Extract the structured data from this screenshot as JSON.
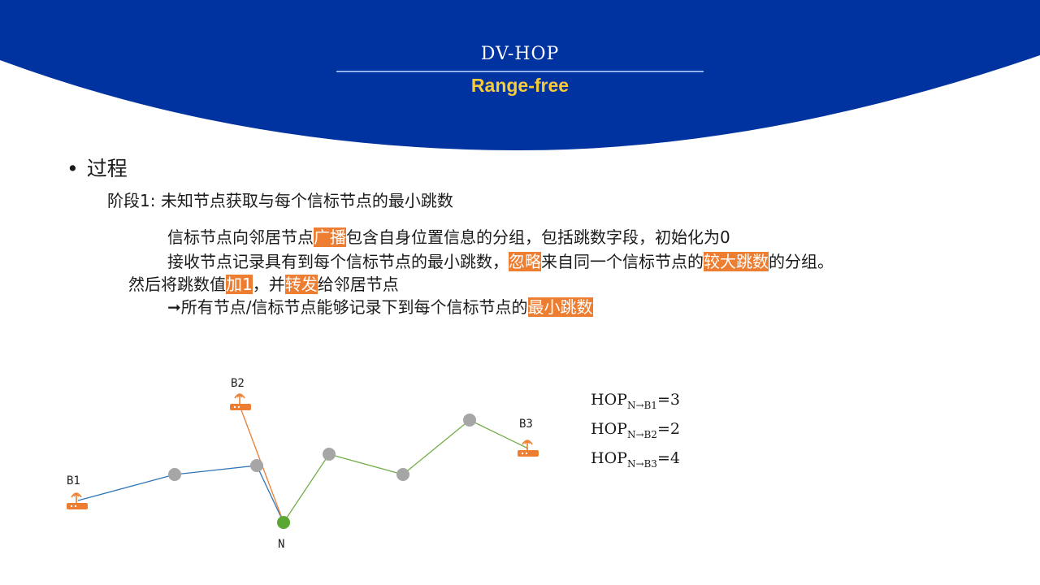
{
  "header": {
    "title": "DV-HOP",
    "subtitle": "Range-free",
    "bg_color": "#0033a0",
    "subtitle_color": "#f5cb3c"
  },
  "section": {
    "bullet": "•",
    "heading": "过程"
  },
  "stage": {
    "label": "阶段1: 未知节点获取与每个信标节点的最小跳数"
  },
  "highlight_color": "#ed7d31",
  "paragraphs": {
    "p1": {
      "a": "信标节点向邻居节点",
      "h1": "广播",
      "b": "包含自身位置信息的分组，包括跳数字段，初始化为0"
    },
    "p2": {
      "a": "接收节点记录具有到每个信标节点的最小跳数，",
      "h1": "忽略",
      "b": "来自同一个信标节点的",
      "h2": "较大跳数",
      "c": "的分组。"
    },
    "p3": {
      "a": "然后将跳数值",
      "h1": "加1",
      "b": "，并",
      "h2": "转发",
      "c": "给邻居节点"
    },
    "p4": {
      "a": "➞所有节点/信标节点能够记录下到每个信标节点的",
      "h1": "最小跳数"
    }
  },
  "hops": [
    {
      "prefix": "HOP",
      "sub": "N→B1",
      "value": "=3"
    },
    {
      "prefix": "HOP",
      "sub": "N→B2",
      "value": "=2"
    },
    {
      "prefix": "HOP",
      "sub": "N→B3",
      "value": "=4"
    }
  ],
  "network": {
    "beacons": [
      {
        "label": "B1",
        "icon": "router-icon"
      },
      {
        "label": "B2",
        "icon": "router-icon"
      },
      {
        "label": "B3",
        "icon": "router-icon"
      }
    ],
    "unknown_node_label": "N",
    "colors": {
      "path_b1": "#2e75b6",
      "path_b2": "#ed7d31",
      "path_b3": "#70ad47",
      "relay_node": "#a6a6a6",
      "target_node": "#5aa832",
      "beacon": "#ed7d31"
    }
  }
}
